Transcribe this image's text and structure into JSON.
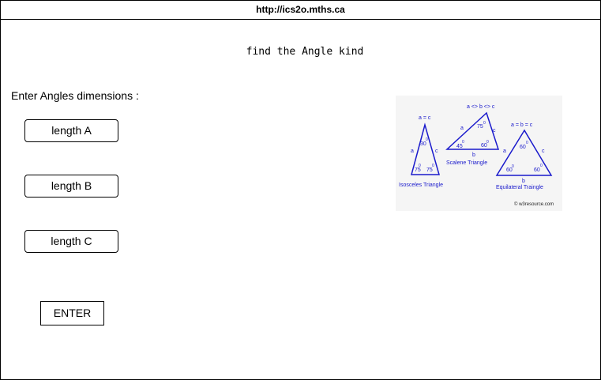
{
  "browser": {
    "url": "http://ics2o.mths.ca"
  },
  "page": {
    "title": "find the Angle kind",
    "prompt": "Enter Angles dimensions :"
  },
  "inputs": {
    "a_placeholder": "length A",
    "b_placeholder": "length B",
    "c_placeholder": "length C"
  },
  "button": {
    "label": "ENTER"
  },
  "diagram": {
    "isosceles": {
      "condition": "a = c",
      "top_angle": "30",
      "left_angle": "75",
      "right_angle": "75",
      "side_left": "a",
      "side_right": "c",
      "caption": "Isosceles Triangle"
    },
    "scalene": {
      "condition": "a <> b <> c",
      "top_angle": "75",
      "left_angle": "45",
      "right_angle": "60",
      "side_left": "a",
      "side_right": "c",
      "side_bottom": "b",
      "caption": "Scalene Triangle"
    },
    "equilateral": {
      "condition": "a = b = c",
      "top_angle": "60",
      "left_angle": "60",
      "right_angle": "60",
      "side_left": "a",
      "side_right": "c",
      "side_bottom": "b",
      "caption": "Equilateral Traingle"
    },
    "degree": "0",
    "credit": "© w3resource.com",
    "color": "#1a1acc"
  }
}
